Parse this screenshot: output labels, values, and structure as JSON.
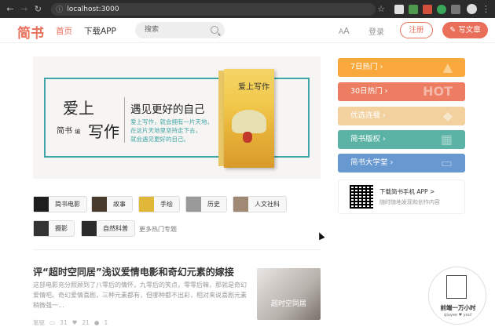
{
  "browser": {
    "url": "localhost:3000"
  },
  "nav": {
    "logo": "简书",
    "home": "首页",
    "download_app": "下载APP",
    "search_placeholder": "搜索",
    "font_toggle_small": "A",
    "font_toggle_large": "A",
    "login": "登录",
    "register": "注册",
    "write": "写文章"
  },
  "banner": {
    "love": "爱上",
    "write": "写作",
    "brand": "简书",
    "brand_suffix": "编",
    "headline": "遇见更好的自己",
    "copy_lines": [
      "爱上写作，就会拥有一片天地，",
      "在这片天地里坚持走下去，",
      "就会遇见更好的自己。"
    ],
    "book_title": "爱上写作"
  },
  "topics": {
    "items": [
      {
        "label": "简书电影"
      },
      {
        "label": "故事"
      },
      {
        "label": "手绘"
      },
      {
        "label": "历史"
      },
      {
        "label": "人文社科"
      },
      {
        "label": "摄影"
      },
      {
        "label": "自然科普"
      }
    ],
    "more": "更多热门专题"
  },
  "article": {
    "title": "评“超时空同居”浅议爱情电影和奇幻元素的嫁接",
    "abstract": "这部电影充分照顾到了八零后的情怀，九零后的笑点，零零后嘛，那就是奇幻爱情吧。奇幻爱情喜剧，三种元素都有，但哪种都不出彩，相对来说喜剧元素稍微强一...",
    "author": "笔驱",
    "comments": "31",
    "likes": "21",
    "rewards": "1",
    "thumb_text": "超时空同居"
  },
  "sidebar": {
    "boards": [
      {
        "label": "7日热门",
        "color": "#f9a93b",
        "deco": ""
      },
      {
        "label": "30日热门",
        "color": "#ec7d62",
        "deco": "HOT"
      },
      {
        "label": "优选连载",
        "color": "#f2d19f",
        "deco": ""
      },
      {
        "label": "简书版权",
        "color": "#5bb3a5",
        "deco": ""
      },
      {
        "label": "简书大学堂",
        "color": "#6798d0",
        "deco": ""
      }
    ],
    "app": {
      "title": "下载简书手机 APP >",
      "subtitle": "随时随地发现和创作内容"
    }
  },
  "badge": {
    "text": "前端一万小时",
    "sub": "qiuyee ♥ you!"
  }
}
